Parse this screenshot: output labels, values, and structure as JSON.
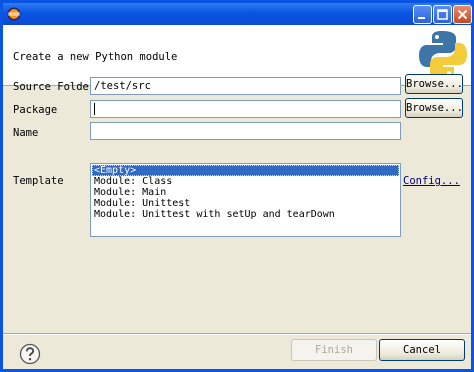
{
  "window": {
    "app_icon": "eclipse-icon",
    "minimize_icon": "minimize-icon",
    "maximize_icon": "maximize-icon",
    "close_icon": "close-icon"
  },
  "banner": {
    "title": "Create a new Python module",
    "logo": "python-logo-icon"
  },
  "form": {
    "source_folder_label": "Source Folder",
    "source_folder_value": "/test/src",
    "package_label": "Package",
    "package_value": "",
    "name_label": "Name",
    "name_value": "",
    "browse_label": "Browse...",
    "template_label": "Template",
    "config_link": "Config...",
    "templates": [
      "<Empty>",
      "Module: Class",
      "Module: Main",
      "Module: Unittest",
      "Module: Unittest with setUp and tearDown"
    ],
    "selected_template": "<Empty>"
  },
  "footer": {
    "help_icon": "help-icon",
    "finish_label": "Finish",
    "cancel_label": "Cancel"
  },
  "colors": {
    "titlebar": "#0a54e3",
    "selection": "#316ac5",
    "dialog_bg": "#ece9d8"
  }
}
